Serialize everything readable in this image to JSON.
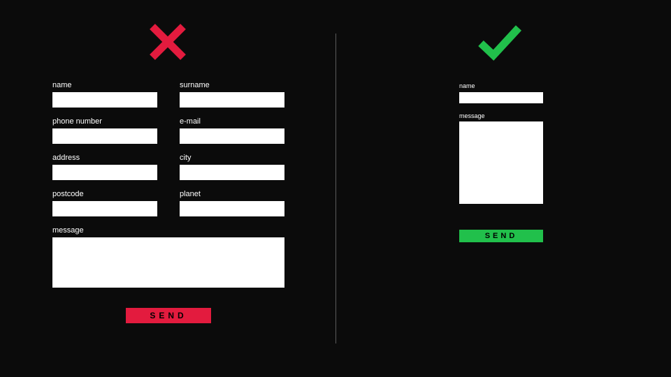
{
  "colors": {
    "danger": "#e31b3e",
    "success": "#21c04b",
    "bg": "#0b0b0b",
    "input": "#ffffff"
  },
  "bad": {
    "icon": "cross",
    "fields": {
      "name": {
        "label": "name",
        "value": ""
      },
      "surname": {
        "label": "surname",
        "value": ""
      },
      "phone": {
        "label": "phone number",
        "value": ""
      },
      "email": {
        "label": "e-mail",
        "value": ""
      },
      "address": {
        "label": "address",
        "value": ""
      },
      "city": {
        "label": "city",
        "value": ""
      },
      "postcode": {
        "label": "postcode",
        "value": ""
      },
      "planet": {
        "label": "planet",
        "value": ""
      },
      "message": {
        "label": "message",
        "value": ""
      }
    },
    "submit_label": "SEND"
  },
  "good": {
    "icon": "check",
    "fields": {
      "name": {
        "label": "name",
        "value": ""
      },
      "message": {
        "label": "message",
        "value": ""
      }
    },
    "submit_label": "SEND"
  }
}
